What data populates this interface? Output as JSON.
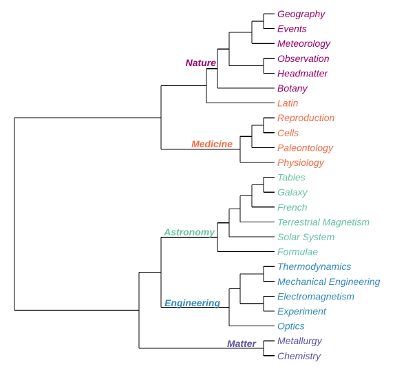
{
  "diagram": {
    "type": "dendrogram",
    "orientation": "left-to-right",
    "clades": [
      {
        "name": "Nature",
        "color": "#990066"
      },
      {
        "name": "Medicine",
        "color": "#f26b45"
      },
      {
        "name": "Astronomy",
        "color": "#66c2a5"
      },
      {
        "name": "Engineering",
        "color": "#3288bd"
      },
      {
        "name": "Matter",
        "color": "#5e4fa2"
      }
    ],
    "leaves": [
      {
        "label": "Geography",
        "clade": "Nature"
      },
      {
        "label": "Events",
        "clade": "Nature"
      },
      {
        "label": "Meteorology",
        "clade": "Nature"
      },
      {
        "label": "Observation",
        "clade": "Nature"
      },
      {
        "label": "Headmatter",
        "clade": "Nature"
      },
      {
        "label": "Botany",
        "clade": "Nature"
      },
      {
        "label": "Latin",
        "clade": "Medicine"
      },
      {
        "label": "Reproduction",
        "clade": "Medicine"
      },
      {
        "label": "Cells",
        "clade": "Medicine"
      },
      {
        "label": "Paleontology",
        "clade": "Medicine"
      },
      {
        "label": "Physiology",
        "clade": "Medicine"
      },
      {
        "label": "Tables",
        "clade": "Astronomy"
      },
      {
        "label": "Galaxy",
        "clade": "Astronomy"
      },
      {
        "label": "French",
        "clade": "Astronomy"
      },
      {
        "label": "Terrestrial Magnetism",
        "clade": "Astronomy"
      },
      {
        "label": "Solar System",
        "clade": "Astronomy"
      },
      {
        "label": "Formulae",
        "clade": "Astronomy"
      },
      {
        "label": "Thermodynamics",
        "clade": "Engineering"
      },
      {
        "label": "Mechanical Engineering",
        "clade": "Engineering"
      },
      {
        "label": "Electromagnetism",
        "clade": "Engineering"
      },
      {
        "label": "Experiment",
        "clade": "Engineering"
      },
      {
        "label": "Optics",
        "clade": "Engineering"
      },
      {
        "label": "Metallurgy",
        "clade": "Matter"
      },
      {
        "label": "Chemistry",
        "clade": "Matter"
      }
    ],
    "tree": [
      [
        [
          [
            [
              [
                "Geography",
                "Events"
              ],
              "Meteorology"
            ],
            [
              "Observation",
              "Headmatter"
            ]
          ],
          "Botany"
        ],
        "Latin"
      ],
      [
        [
          [
            "Reproduction",
            "Cells"
          ],
          "Paleontology"
        ],
        "Physiology"
      ]
    ],
    "tree_lower": [
      [
        [
          [
            [
              [
                "Tables",
                "Galaxy"
              ],
              "French"
            ],
            "Terrestrial Magnetism"
          ],
          "Solar System"
        ],
        "Formulae"
      ],
      [
        [
          [
            [
              "Thermodynamics",
              "Mechanical Engineering"
            ],
            [
              "Electromagnetism",
              "Experiment"
            ]
          ],
          "Optics"
        ],
        [
          "Metallurgy",
          "Chemistry"
        ]
      ]
    ]
  }
}
